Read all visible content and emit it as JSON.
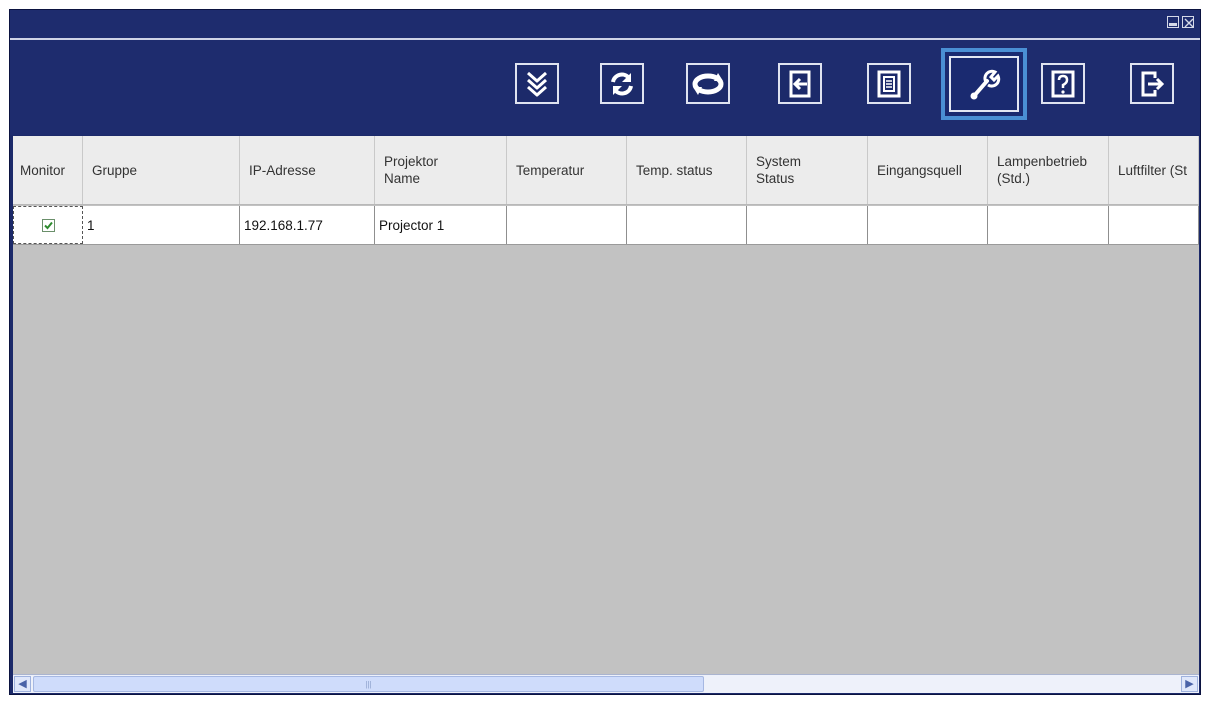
{
  "toolbar": {
    "buttons": [
      {
        "icon": "expand-down-icon",
        "active": false
      },
      {
        "icon": "refresh-icon",
        "active": false
      },
      {
        "icon": "refresh-all-icon",
        "active": false
      },
      {
        "icon": "import-icon",
        "active": false
      },
      {
        "icon": "save-icon",
        "active": false
      },
      {
        "icon": "tools-icon",
        "active": true
      },
      {
        "icon": "help-icon",
        "active": false
      },
      {
        "icon": "exit-icon",
        "active": false
      }
    ]
  },
  "table": {
    "columns": [
      "Monitor",
      "Gruppe",
      "IP-Adresse",
      "Projektor\nName",
      "Temperatur",
      "Temp. status",
      "System\nStatus",
      "Eingangsquell",
      "Lampenbetrieb\n(Std.)",
      "Luftfilter (St"
    ],
    "rows": [
      {
        "monitor_checked": true,
        "gruppe": "1",
        "ip": "192.168.1.77",
        "name": "Projector 1",
        "temperatur": "",
        "temp_status": "",
        "system_status": "",
        "eingangsquelle": "",
        "lampenbetrieb": "",
        "luftfilter": ""
      }
    ]
  },
  "colors": {
    "window_bg": "#1e2c6e",
    "active_border": "#4a8fd4",
    "grid_bg": "#c2c2c2",
    "header_bg": "#ececec"
  },
  "scrollbar": {
    "grip": "|||"
  }
}
